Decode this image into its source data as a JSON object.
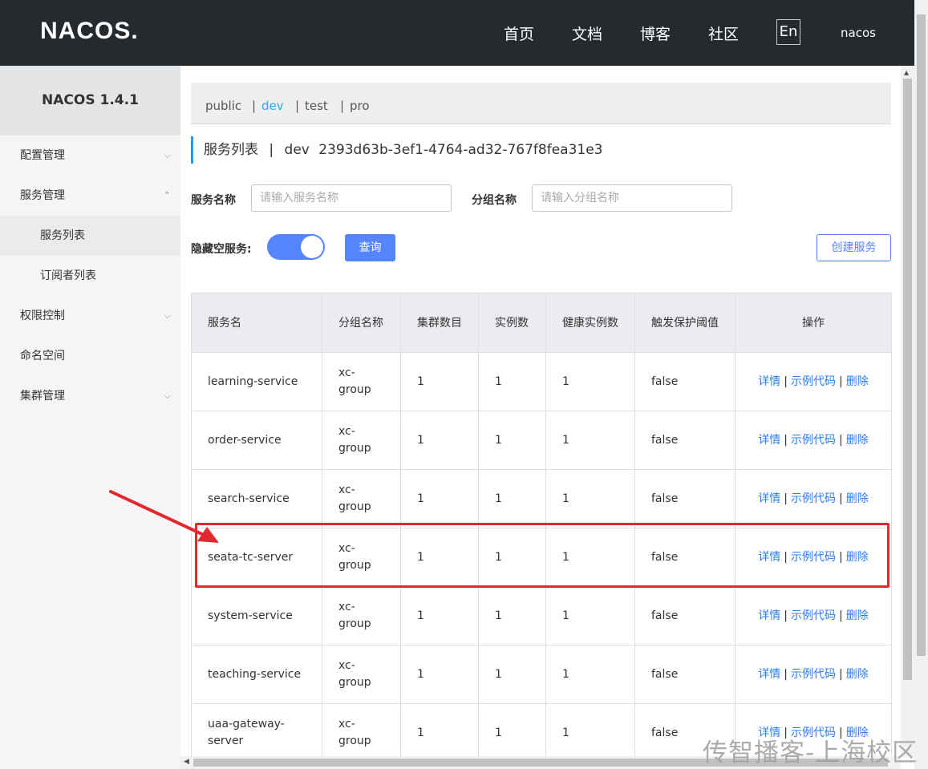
{
  "header": {
    "logo": "NACOS.",
    "nav": [
      "首页",
      "文档",
      "博客",
      "社区"
    ],
    "lang": "En",
    "user": "nacos"
  },
  "sidebar": {
    "brand": "NACOS 1.4.1",
    "items": [
      {
        "label": "配置管理"
      },
      {
        "label": "服务管理"
      },
      {
        "label": "服务列表"
      },
      {
        "label": "订阅者列表"
      },
      {
        "label": "权限控制"
      },
      {
        "label": "命名空间"
      },
      {
        "label": "集群管理"
      }
    ]
  },
  "namespaces": {
    "items": [
      "public",
      "dev",
      "test",
      "pro"
    ],
    "separator": "|",
    "active": "dev"
  },
  "page": {
    "title": "服务列表",
    "separator": "|",
    "namespace_name": "dev",
    "namespace_id": "2393d63b-3ef1-4764-ad32-767f8fea31e3"
  },
  "filters": {
    "service_name_label": "服务名称",
    "service_name_placeholder": "请输入服务名称",
    "group_name_label": "分组名称",
    "group_name_placeholder": "请输入分组名称",
    "hide_empty_label": "隐藏空服务:",
    "hide_empty_on": true,
    "query_button": "查询",
    "create_button": "创建服务"
  },
  "table": {
    "columns": [
      "服务名",
      "分组名称",
      "集群数目",
      "实例数",
      "健康实例数",
      "触发保护阈值",
      "操作"
    ],
    "actions": {
      "detail": "详情",
      "sample": "示例代码",
      "delete": "删除",
      "separator": "|"
    },
    "rows": [
      {
        "name": "learning-service",
        "group": "xc-group",
        "clusters": "1",
        "instances": "1",
        "healthy": "1",
        "threshold": "false"
      },
      {
        "name": "order-service",
        "group": "xc-group",
        "clusters": "1",
        "instances": "1",
        "healthy": "1",
        "threshold": "false"
      },
      {
        "name": "search-service",
        "group": "xc-group",
        "clusters": "1",
        "instances": "1",
        "healthy": "1",
        "threshold": "false"
      },
      {
        "name": "seata-tc-server",
        "group": "xc-group",
        "clusters": "1",
        "instances": "1",
        "healthy": "1",
        "threshold": "false"
      },
      {
        "name": "system-service",
        "group": "xc-group",
        "clusters": "1",
        "instances": "1",
        "healthy": "1",
        "threshold": "false"
      },
      {
        "name": "teaching-service",
        "group": "xc-group",
        "clusters": "1",
        "instances": "1",
        "healthy": "1",
        "threshold": "false"
      },
      {
        "name": "uaa-gateway-server",
        "group": "xc-group",
        "clusters": "1",
        "instances": "1",
        "healthy": "1",
        "threshold": "false"
      }
    ]
  },
  "annotation": {
    "highlight_color": "#e4282f",
    "highlighted_row": "seata-tc-server"
  },
  "watermark": "传智播客-上海校区",
  "colors": {
    "header_bg": "#252a2f",
    "primary": "#5584ff",
    "link": "#2a7ce8",
    "active_ns": "#1fb0e8"
  }
}
